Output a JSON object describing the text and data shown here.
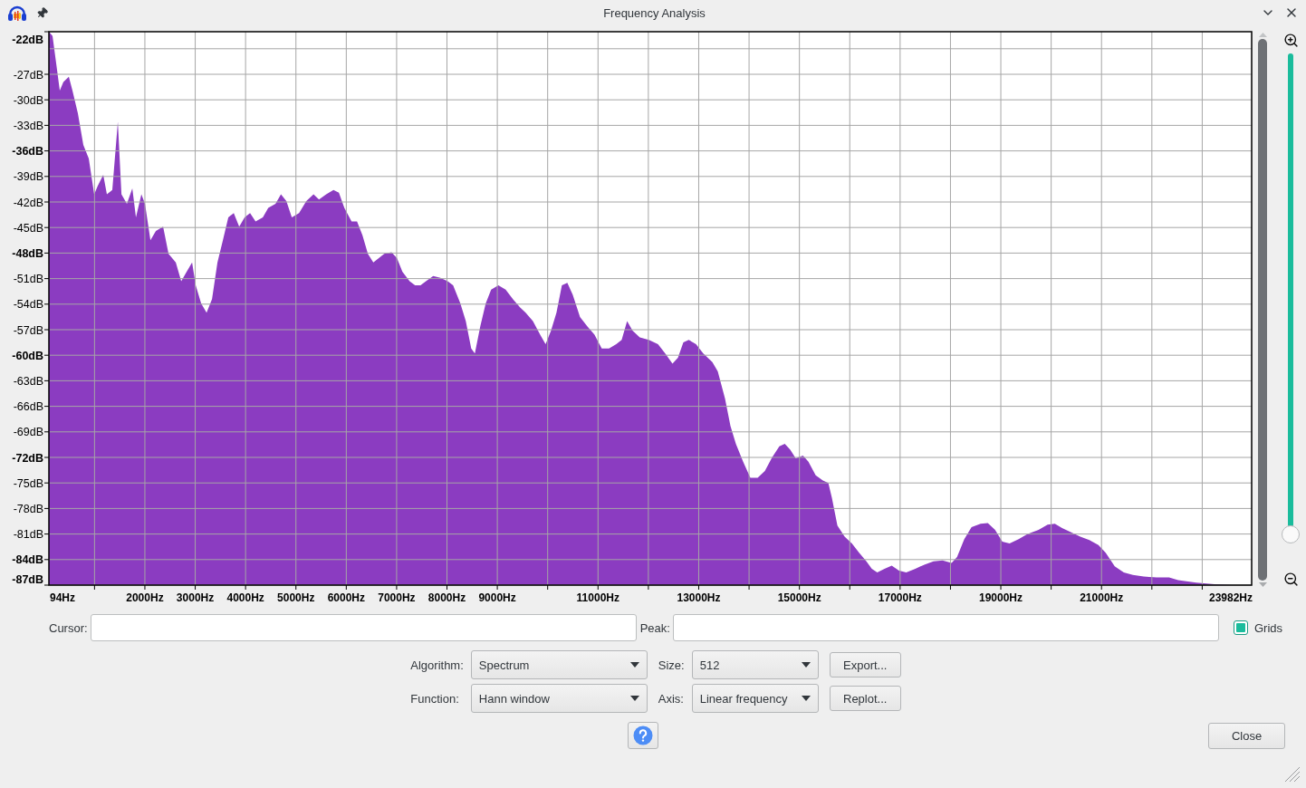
{
  "window": {
    "title": "Frequency Analysis"
  },
  "plot": {
    "chart_data": {
      "type": "area",
      "x": [
        94,
        95,
        166,
        238,
        310,
        382,
        490,
        562,
        670,
        778,
        886,
        994,
        1066,
        1174,
        1246,
        1354,
        1462,
        1534,
        1642,
        1750,
        1822,
        1930,
        2002,
        2110,
        2218,
        2362,
        2470,
        2614,
        2722,
        2830,
        2938,
        3010,
        3118,
        3226,
        3334,
        3442,
        3550,
        3658,
        3766,
        3874,
        3982,
        4090,
        4198,
        4342,
        4450,
        4594,
        4702,
        4810,
        4918,
        5062,
        5206,
        5350,
        5458,
        5602,
        5746,
        5854,
        5962,
        6106,
        6214,
        6322,
        6430,
        6538,
        6646,
        6754,
        6898,
        7006,
        7114,
        7258,
        7366,
        7474,
        7582,
        7726,
        7870,
        8014,
        8122,
        8266,
        8374,
        8482,
        8554,
        8662,
        8770,
        8878,
        9022,
        9166,
        9310,
        9454,
        9562,
        9706,
        9850,
        9958,
        10066,
        10174,
        10282,
        10390,
        10498,
        10642,
        10786,
        10930,
        11074,
        11218,
        11362,
        11470,
        11578,
        11686,
        11830,
        12010,
        12190,
        12334,
        12478,
        12586,
        12694,
        12802,
        12946,
        13090,
        13270,
        13378,
        13522,
        13630,
        13738,
        13882,
        14026,
        14170,
        14314,
        14458,
        14602,
        14710,
        14818,
        14926,
        15070,
        15178,
        15322,
        15466,
        15574,
        15646,
        15754,
        15898,
        16042,
        16186,
        16330,
        16438,
        16546,
        16690,
        16834,
        16978,
        17122,
        17302,
        17482,
        17662,
        17842,
        18022,
        18130,
        18274,
        18418,
        18598,
        18742,
        18886,
        19030,
        19174,
        19354,
        19534,
        19750,
        19930,
        20074,
        20218,
        20398,
        20578,
        20758,
        20938,
        21082,
        21262,
        21442,
        21622,
        21838,
        22090,
        22342,
        22522,
        22882,
        23242,
        23602,
        23982
      ],
      "series": [
        {
          "color": "#8b3cc1",
          "values": [
            -87.0,
            -22.0,
            -22.5,
            -25.7,
            -28.9,
            -27.9,
            -27.3,
            -28.9,
            -31.6,
            -35.3,
            -36.9,
            -41.1,
            -40.1,
            -38.8,
            -41.1,
            -40.6,
            -32.6,
            -41.1,
            -42.2,
            -40.4,
            -43.8,
            -41.1,
            -42.2,
            -46.5,
            -45.4,
            -44.9,
            -48.1,
            -49.1,
            -51.3,
            -50.2,
            -49.1,
            -51.8,
            -53.9,
            -55.0,
            -53.4,
            -49.1,
            -46.5,
            -43.8,
            -43.3,
            -44.9,
            -43.8,
            -43.3,
            -44.3,
            -43.8,
            -42.7,
            -42.2,
            -41.1,
            -41.9,
            -43.8,
            -43.3,
            -41.9,
            -41.1,
            -41.7,
            -41.1,
            -40.6,
            -40.9,
            -42.7,
            -44.3,
            -44.3,
            -45.9,
            -48.1,
            -49.1,
            -48.6,
            -48.1,
            -47.9,
            -48.6,
            -50.2,
            -51.3,
            -51.8,
            -51.8,
            -51.3,
            -50.7,
            -50.9,
            -51.3,
            -51.8,
            -53.9,
            -56.0,
            -59.2,
            -59.8,
            -56.6,
            -53.9,
            -52.3,
            -51.8,
            -52.3,
            -53.4,
            -54.4,
            -55.0,
            -56.0,
            -57.6,
            -58.7,
            -57.1,
            -55.0,
            -51.8,
            -51.5,
            -52.9,
            -55.5,
            -56.6,
            -57.6,
            -59.2,
            -59.2,
            -58.7,
            -58.2,
            -56.0,
            -57.1,
            -57.9,
            -58.2,
            -58.7,
            -59.8,
            -61.0,
            -60.3,
            -58.5,
            -58.2,
            -58.7,
            -59.8,
            -60.8,
            -61.9,
            -65.1,
            -68.3,
            -70.4,
            -72.5,
            -74.4,
            -74.4,
            -73.6,
            -72.0,
            -70.7,
            -70.4,
            -71.1,
            -72.1,
            -71.8,
            -72.5,
            -74.1,
            -74.7,
            -75.0,
            -76.8,
            -80.0,
            -81.3,
            -82.1,
            -83.2,
            -84.2,
            -85.1,
            -85.5,
            -85.1,
            -84.7,
            -85.3,
            -85.5,
            -85.1,
            -84.6,
            -84.2,
            -84.1,
            -84.4,
            -83.7,
            -81.6,
            -80.2,
            -79.8,
            -79.7,
            -80.5,
            -81.9,
            -82.1,
            -81.6,
            -81.0,
            -80.5,
            -79.9,
            -79.8,
            -80.3,
            -80.8,
            -81.3,
            -81.7,
            -82.3,
            -83.2,
            -84.8,
            -85.5,
            -85.8,
            -86.0,
            -86.1,
            -86.1,
            -86.4,
            -86.7,
            -86.9,
            -87.0,
            -87.0
          ]
        }
      ],
      "xlim": [
        94,
        23982
      ],
      "ylim": [
        -87,
        -22
      ],
      "grid": true,
      "xticks": [
        {
          "value": 94,
          "label": "94Hz"
        },
        {
          "value": 2000,
          "label": "2000Hz"
        },
        {
          "value": 3000,
          "label": "3000Hz"
        },
        {
          "value": 4000,
          "label": "4000Hz"
        },
        {
          "value": 5000,
          "label": "5000Hz"
        },
        {
          "value": 6000,
          "label": "6000Hz"
        },
        {
          "value": 7000,
          "label": "7000Hz"
        },
        {
          "value": 8000,
          "label": "8000Hz"
        },
        {
          "value": 9000,
          "label": "9000Hz"
        },
        {
          "value": 11000,
          "label": "11000Hz"
        },
        {
          "value": 13000,
          "label": "13000Hz"
        },
        {
          "value": 15000,
          "label": "15000Hz"
        },
        {
          "value": 17000,
          "label": "17000Hz"
        },
        {
          "value": 19000,
          "label": "19000Hz"
        },
        {
          "value": 21000,
          "label": "21000Hz"
        },
        {
          "value": 23982,
          "label": "23982Hz"
        }
      ],
      "yticks": [
        {
          "value": -22,
          "label": "-22dB"
        },
        {
          "value": -27,
          "label": "-27dB"
        },
        {
          "value": -30,
          "label": "-30dB"
        },
        {
          "value": -33,
          "label": "-33dB"
        },
        {
          "value": -36,
          "label": "-36dB"
        },
        {
          "value": -39,
          "label": "-39dB"
        },
        {
          "value": -42,
          "label": "-42dB"
        },
        {
          "value": -45,
          "label": "-45dB"
        },
        {
          "value": -48,
          "label": "-48dB"
        },
        {
          "value": -51,
          "label": "-51dB"
        },
        {
          "value": -54,
          "label": "-54dB"
        },
        {
          "value": -57,
          "label": "-57dB"
        },
        {
          "value": -60,
          "label": "-60dB"
        },
        {
          "value": -63,
          "label": "-63dB"
        },
        {
          "value": -66,
          "label": "-66dB"
        },
        {
          "value": -69,
          "label": "-69dB"
        },
        {
          "value": -72,
          "label": "-72dB"
        },
        {
          "value": -75,
          "label": "-75dB"
        },
        {
          "value": -78,
          "label": "-78dB"
        },
        {
          "value": -81,
          "label": "-81dB"
        },
        {
          "value": -84,
          "label": "-84dB"
        },
        {
          "value": -87,
          "label": "-87dB"
        }
      ]
    }
  },
  "zoom_slider": {
    "level": 0.95
  },
  "cursor": {
    "label": "Cursor:"
  },
  "peak": {
    "label": "Peak:"
  },
  "grids": {
    "label": "Grids",
    "checked": true
  },
  "options": [
    {
      "label": "Algorithm:",
      "value": "Spectrum"
    },
    {
      "label": "Size:",
      "value": "512"
    },
    {
      "label": "Function:",
      "value": "Hann window"
    },
    {
      "label": "Axis:",
      "value": "Linear frequency"
    }
  ],
  "buttons": {
    "export": "Export...",
    "replot": "Replot...",
    "close": "Close"
  }
}
